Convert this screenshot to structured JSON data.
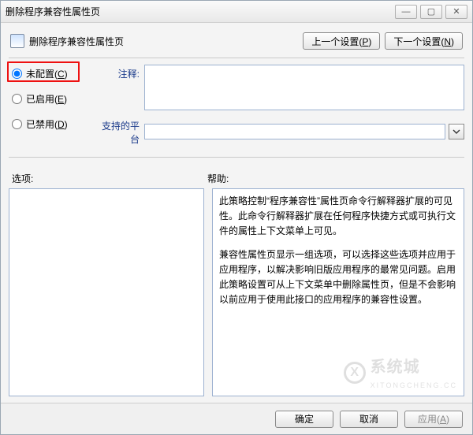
{
  "window": {
    "title": "删除程序兼容性属性页",
    "min_icon": "—",
    "max_icon": "▢",
    "close_icon": "✕"
  },
  "header": {
    "title": "删除程序兼容性属性页",
    "prev_label": "上一个设置(P)",
    "next_label": "下一个设置(N)"
  },
  "radios": {
    "not_configured": "未配置(C)",
    "enabled": "已启用(E)",
    "disabled": "已禁用(D)",
    "selected": "not_configured"
  },
  "form": {
    "notes_label": "注释:",
    "notes_value": "",
    "platform_label": "支持的平台",
    "platform_value": ""
  },
  "sections": {
    "options_label": "选项:",
    "help_label": "帮助:"
  },
  "help": {
    "p1": "此策略控制“程序兼容性”属性页命令行解释器扩展的可见性。此命令行解释器扩展在任何程序快捷方式或可执行文件的属性上下文菜单上可见。",
    "p2": "兼容性属性页显示一组选项，可以选择这些选项并应用于应用程序，以解决影响旧版应用程序的最常见问题。启用此策略设置可从上下文菜单中删除属性页，但是不会影响以前应用于使用此接口的应用程序的兼容性设置。"
  },
  "footer": {
    "ok": "确定",
    "cancel": "取消",
    "apply": "应用(A)"
  },
  "watermark": {
    "text": "系统城",
    "sub": "XITONGCHENG.CC"
  }
}
